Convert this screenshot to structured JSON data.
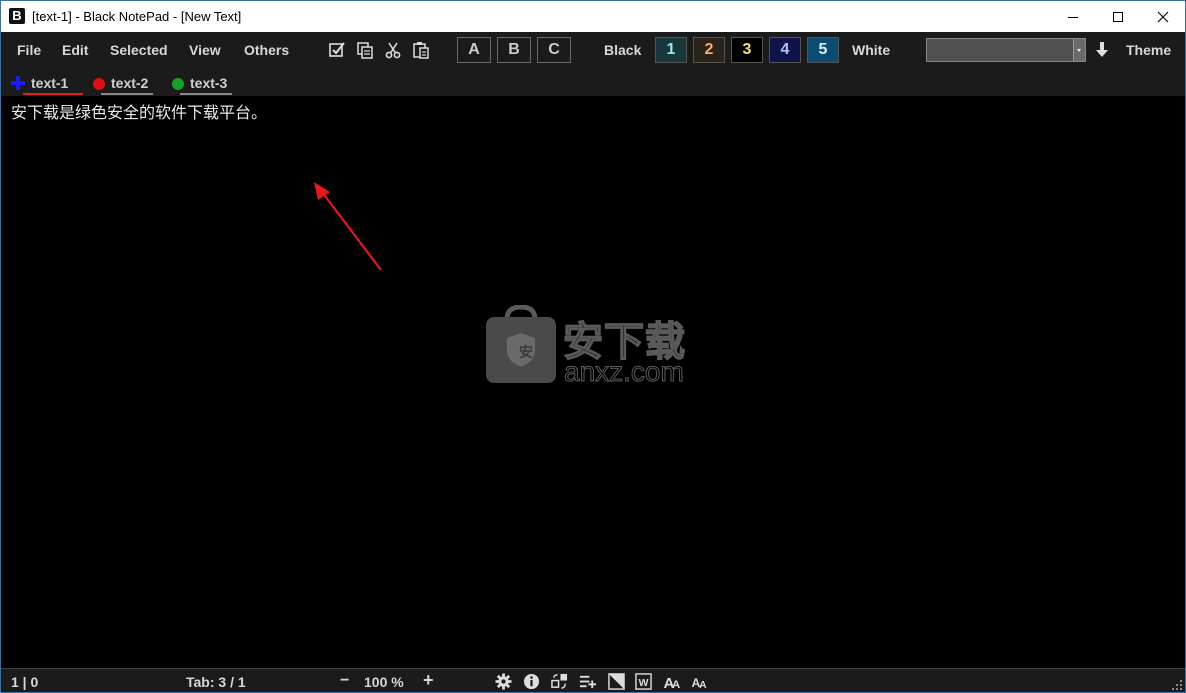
{
  "window": {
    "title": "[text-1] - Black NotePad - [New Text]",
    "app_icon_letter": "B",
    "border_color": "#3d6fa8"
  },
  "menu": {
    "file": "File",
    "edit": "Edit",
    "selected": "Selected",
    "view": "View",
    "others": "Others"
  },
  "toolbar": {
    "icons": [
      "check-square-icon",
      "copy-icon",
      "cut-icon",
      "paste-icon"
    ],
    "slot_buttons": [
      "A",
      "B",
      "C"
    ],
    "black_label": "Black",
    "white_label": "White",
    "theme_label": "Theme",
    "theme_buttons": [
      {
        "label": "1",
        "bg": "#16383a",
        "fg": "#9ee6f0"
      },
      {
        "label": "2",
        "bg": "#2a2118",
        "fg": "#f0b070"
      },
      {
        "label": "3",
        "bg": "#000000",
        "fg": "#f2e65a"
      },
      {
        "label": "4",
        "bg": "#10124a",
        "fg": "#b8c0ff"
      },
      {
        "label": "5",
        "bg": "#0b4c75",
        "fg": "#d8eef8"
      }
    ],
    "theme_select_value": ""
  },
  "tabs": [
    {
      "label": "text-1",
      "marker_color": "#1a1aff",
      "marker": "plus",
      "underline_color": "#e02020",
      "active": true
    },
    {
      "label": "text-2",
      "marker_color": "#e01010",
      "marker": "dot",
      "underline_color": "#888888",
      "active": false
    },
    {
      "label": "text-3",
      "marker_color": "#159e2a",
      "marker": "dot",
      "underline_color": "#888888",
      "active": false
    }
  ],
  "editor": {
    "content": "安下载是绿色安全的软件下载平台。"
  },
  "watermark": {
    "name": "安下载",
    "domain": "anxz.com"
  },
  "status": {
    "cursor": "1 | 0",
    "tab": "Tab: 3 / 1",
    "zoom_minus": "−",
    "zoom": "100 %",
    "zoom_plus": "+",
    "icons": [
      "gear-icon",
      "info-icon",
      "swap-icon",
      "list-add-icon",
      "invert-icon",
      "word-wrap-icon",
      "font-increase-icon",
      "font-decrease-icon"
    ]
  }
}
